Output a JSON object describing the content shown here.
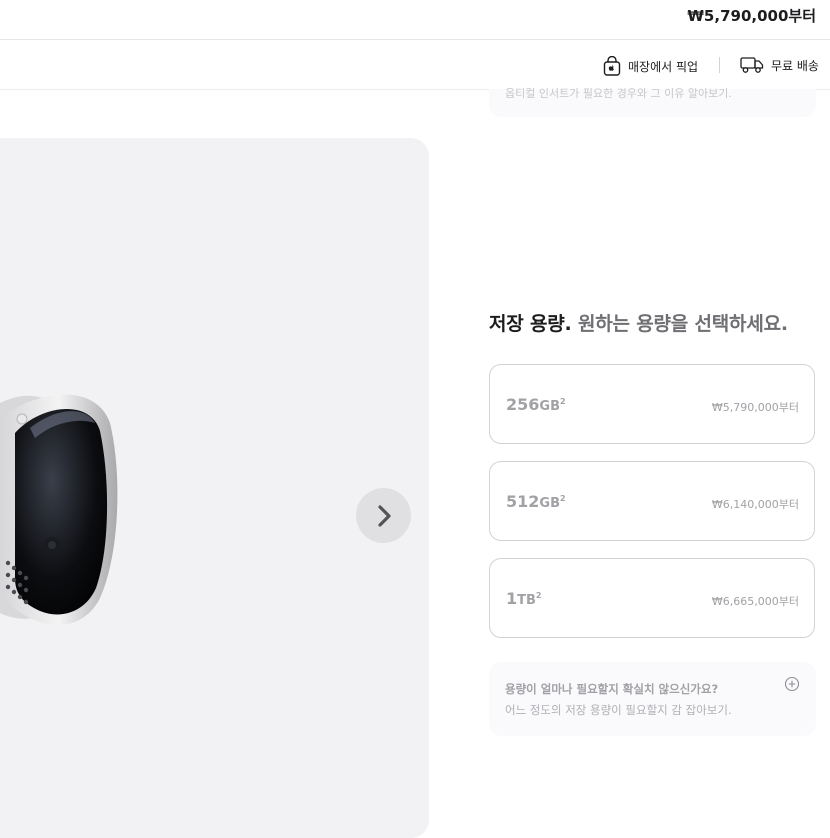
{
  "header": {
    "price": "₩5,790,000부터"
  },
  "subbar": {
    "pickup_label": "매장에서 픽업",
    "shipping_label": "무료 배송"
  },
  "top_note": "옵티컬 인서트가 필요한 경우와 그 이유 알아보기.",
  "storage": {
    "heading_strong": "저장 용량.",
    "heading_muted": "원하는 용량을 선택하세요.",
    "options": [
      {
        "number": "256",
        "unit": "GB",
        "footnote": "2",
        "price": "₩5,790,000부터"
      },
      {
        "number": "512",
        "unit": "GB",
        "footnote": "2",
        "price": "₩6,140,000부터"
      },
      {
        "number": "1",
        "unit": "TB",
        "footnote": "2",
        "price": "₩6,665,000부터"
      }
    ],
    "help": {
      "question": "용량이 얼마나 필요할지 확실치 않으신가요?",
      "answer": "어느 정도의 저장 용량이 필요할지 감 잡아보기."
    }
  },
  "icons": {
    "pickup": "apple-bag-icon",
    "shipping": "truck-icon",
    "next": "chevron-right-icon",
    "help": "plus-circle-icon"
  }
}
